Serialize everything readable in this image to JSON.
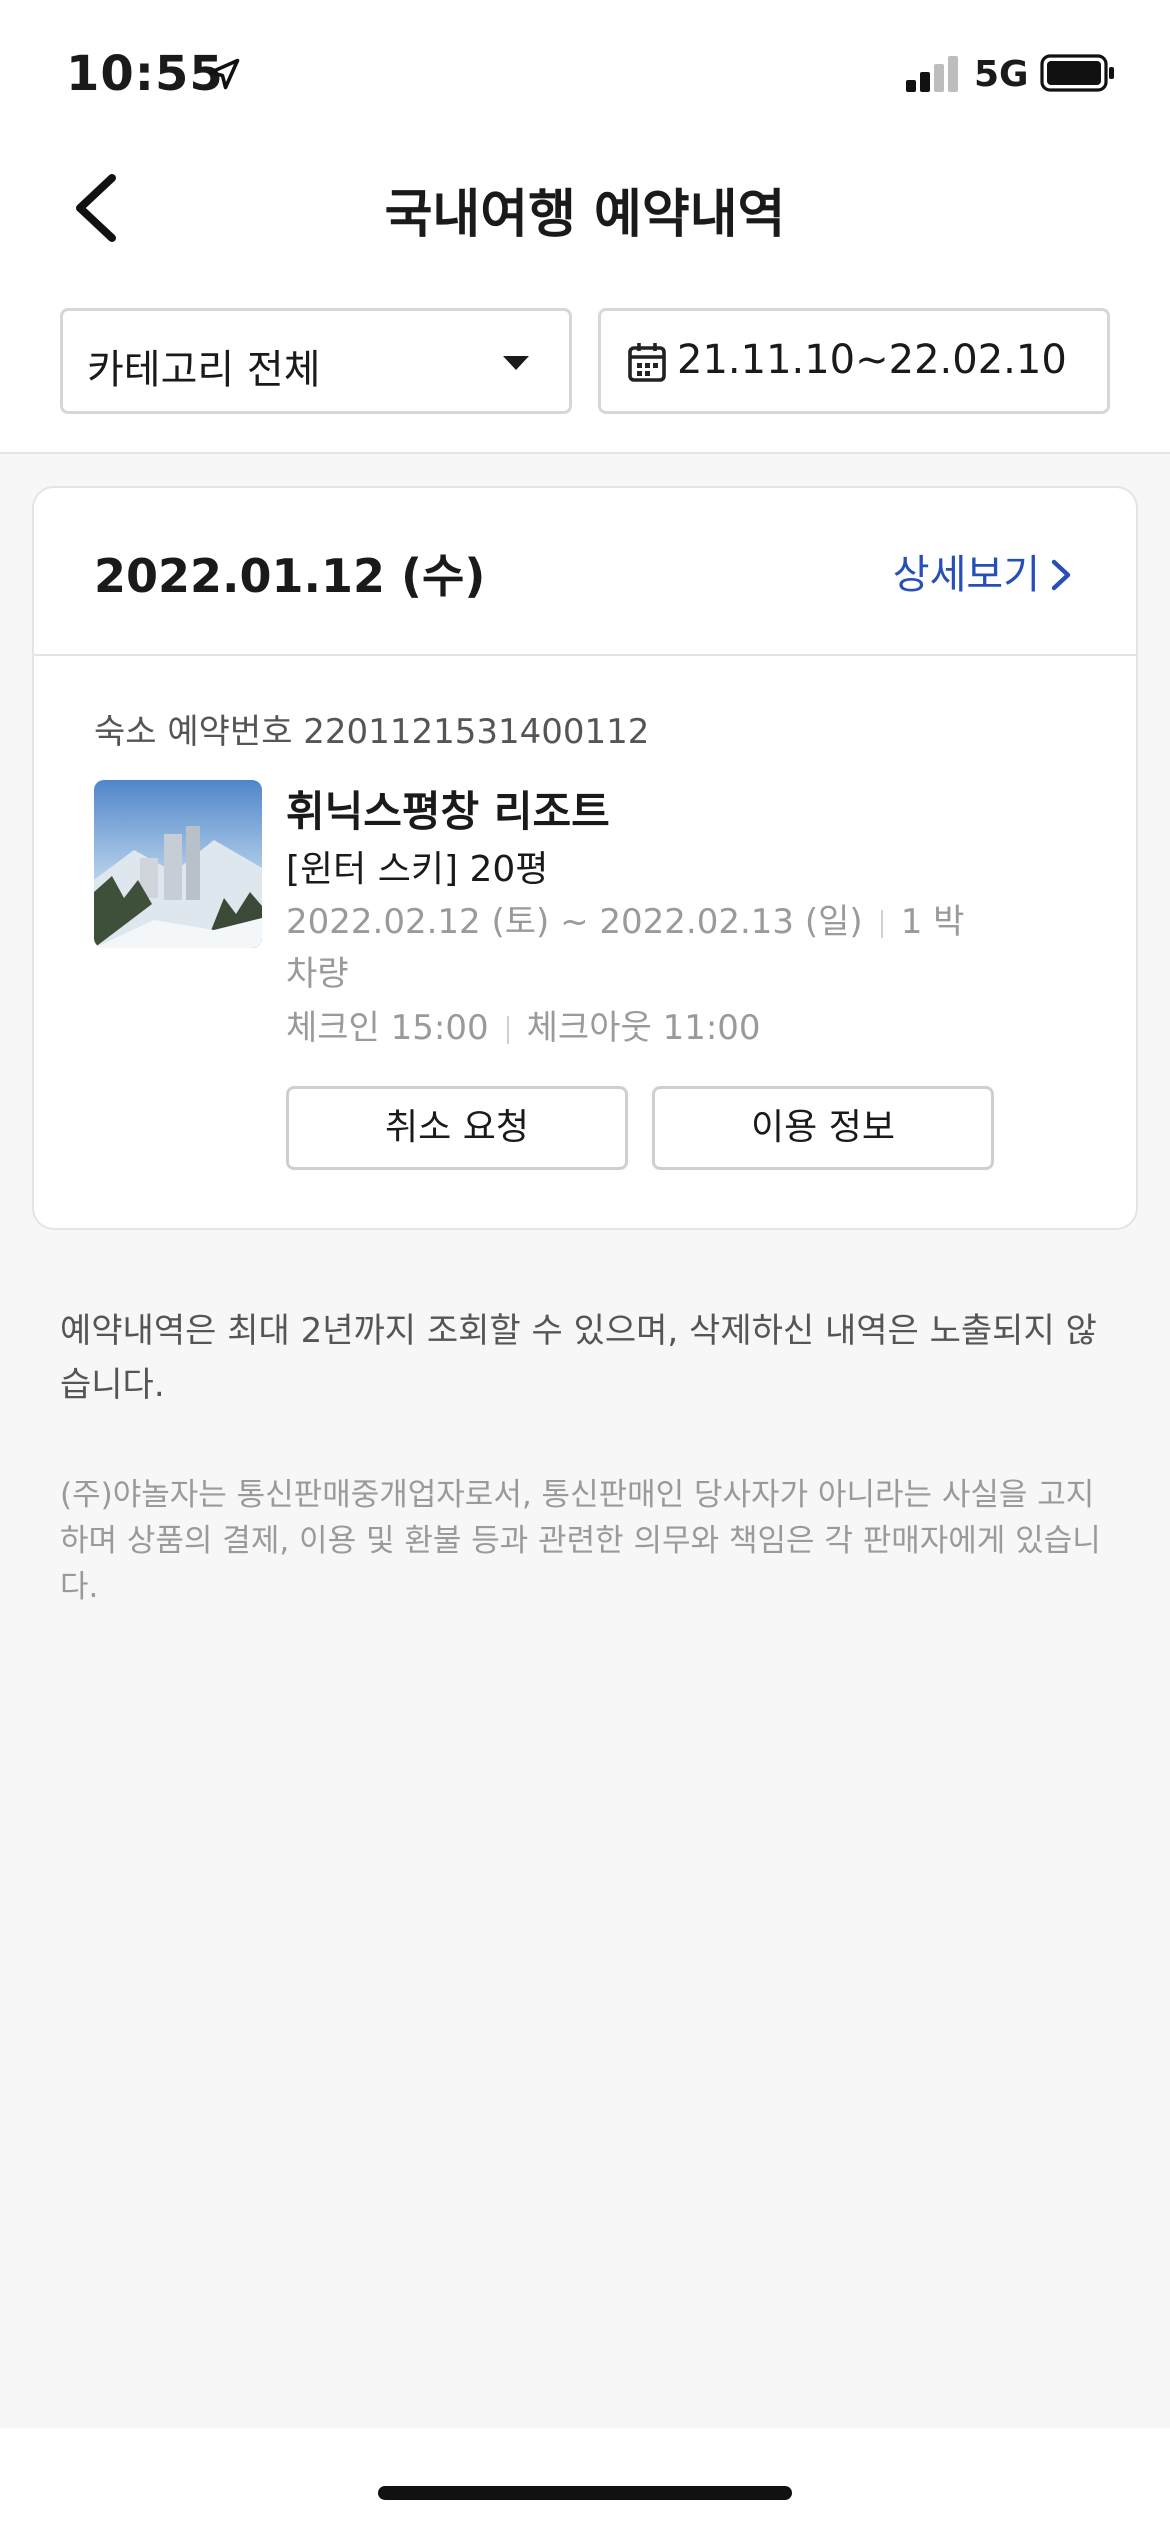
{
  "status": {
    "time": "10:55",
    "network": "5G"
  },
  "header": {
    "title": "국내여행 예약내역"
  },
  "filters": {
    "category": "카테고리 전체",
    "date_range": "21.11.10~22.02.10"
  },
  "reservation": {
    "date": "2022.01.12 (수)",
    "detail_link": "상세보기",
    "number": "숙소 예약번호 2201121531400112",
    "hotel_name": "휘닉스평창 리조트",
    "room": "[윈터 스키] 20평",
    "stay_dates": "2022.02.12 (토) ~ 2022.02.13 (일)",
    "nights": "1 박",
    "parking": "차량",
    "checkin": "체크인 15:00",
    "checkout": "체크아웃 11:00",
    "cancel_button": "취소 요청",
    "info_button": "이용 정보"
  },
  "notes": {
    "retention": "예약내역은 최대 2년까지 조회할 수 있으며, 삭제하신 내역은 노출되지 않습니다.",
    "disclaimer": "(주)야놀자는 통신판매중개업자로서, 통신판매인 당사자가 아니라는 사실을 고지하며 상품의 결제, 이용 및 환불 등과 관련한 의무와 책임은 각 판매자에게 있습니다."
  },
  "colors": {
    "accent": "#2650b8",
    "background": "#f7f7f8"
  }
}
